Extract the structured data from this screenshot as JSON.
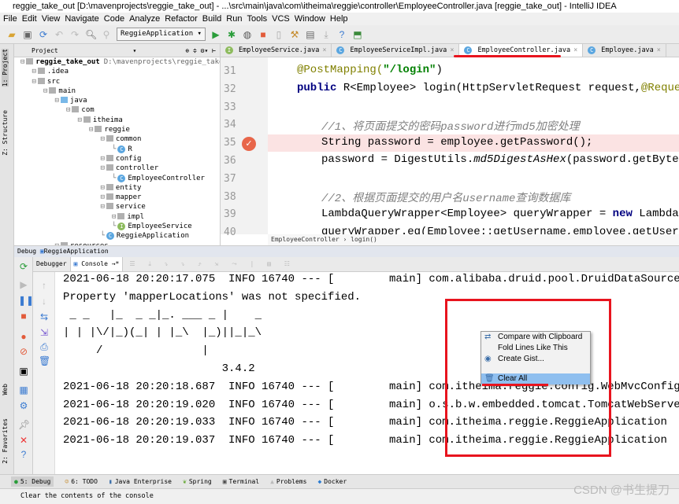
{
  "window": {
    "title": "reggie_take_out [D:\\mavenprojects\\reggie_take_out] - ...\\src\\main\\java\\com\\itheima\\reggie\\controller\\EmployeeController.java [reggie_take_out] - IntelliJ IDEA"
  },
  "menu": [
    "File",
    "Edit",
    "View",
    "Navigate",
    "Code",
    "Analyze",
    "Refactor",
    "Build",
    "Run",
    "Tools",
    "VCS",
    "Window",
    "Help"
  ],
  "toolbar": {
    "run_config": "ReggieApplication"
  },
  "side_tabs": {
    "project": "1: Project",
    "structure": "Z: Structure",
    "web": "Web",
    "favorites": "2: Favorites"
  },
  "project": {
    "header": "Project",
    "tree": [
      {
        "label": "reggie_take_out",
        "extra": "D:\\mavenprojects\\reggie_take_",
        "depth": 0,
        "type": "module"
      },
      {
        "label": ".idea",
        "depth": 1,
        "type": "folder"
      },
      {
        "label": "src",
        "depth": 1,
        "type": "folder"
      },
      {
        "label": "main",
        "depth": 2,
        "type": "folder"
      },
      {
        "label": "java",
        "depth": 3,
        "type": "source"
      },
      {
        "label": "com",
        "depth": 4,
        "type": "folder"
      },
      {
        "label": "itheima",
        "depth": 5,
        "type": "folder"
      },
      {
        "label": "reggie",
        "depth": 6,
        "type": "folder"
      },
      {
        "label": "common",
        "depth": 7,
        "type": "folder"
      },
      {
        "label": "R",
        "depth": 8,
        "type": "class"
      },
      {
        "label": "config",
        "depth": 7,
        "type": "folder"
      },
      {
        "label": "controller",
        "depth": 7,
        "type": "folder"
      },
      {
        "label": "EmployeeController",
        "depth": 8,
        "type": "class"
      },
      {
        "label": "entity",
        "depth": 7,
        "type": "folder"
      },
      {
        "label": "mapper",
        "depth": 7,
        "type": "folder"
      },
      {
        "label": "service",
        "depth": 7,
        "type": "folder"
      },
      {
        "label": "impl",
        "depth": 8,
        "type": "folder"
      },
      {
        "label": "EmployeeService",
        "depth": 8,
        "type": "interface"
      },
      {
        "label": "ReggieApplication",
        "depth": 7,
        "type": "app"
      },
      {
        "label": "resources",
        "depth": 3,
        "type": "folder"
      }
    ]
  },
  "editor": {
    "tabs": [
      {
        "label": "EmployeeService.java",
        "icon": "I",
        "active": false
      },
      {
        "label": "EmployeeServiceImpl.java",
        "icon": "C",
        "active": false
      },
      {
        "label": "EmployeeController.java",
        "icon": "C",
        "active": true
      },
      {
        "label": "Employee.java",
        "icon": "C",
        "active": false
      }
    ],
    "line_numbers": [
      "31",
      "32",
      "33",
      "34",
      "35",
      "36",
      "37",
      "38",
      "39",
      "40"
    ],
    "lines": {
      "l31a": "@PostMapping(",
      "l31b": "\"/login\"",
      "l31c": ")",
      "l32a": "public",
      "l32b": " R<Employee> login(HttpServletRequest request,",
      "l32c": "@RequestBody",
      "l34": "//1、将页面提交的密码password进行md5加密处理",
      "l35": "String password = employee.getPassword();",
      "l36a": "password = DigestUtils.",
      "l36b": "md5DigestAsHex",
      "l36c": "(password.getBytes());",
      "l38": "//2、根据页面提交的用户名username查询数据库",
      "l39a": "LambdaQueryWrapper<Employee> queryWrapper = ",
      "l39b": "new",
      "l39c": " LambdaQueryWrapper<>();",
      "l40": "queryWrapper.eq(Employee::getUsername,employee.getUsername());"
    },
    "breakpoint_line": "35",
    "breadcrumb": [
      "EmployeeController",
      "login()"
    ]
  },
  "debug": {
    "label": "Debug",
    "config": "ReggieApplication",
    "tabs": [
      "Debugger",
      "Console"
    ]
  },
  "console": {
    "lines": [
      {
        "left": "2021-06-18 20:20:17.075  INFO 16740 --- [",
        "right": "main] com.alibaba.druid.pool.DruidDataSource"
      },
      {
        "left": "Property 'mapperLocations' was not specified.",
        "right": ""
      },
      {
        "left": " _ _   |_  _ _|_. ___ _ |    _",
        "right": ""
      },
      {
        "left": "| | |\\/|_)(_| | |_\\  |_)||_|_\\",
        "right": ""
      },
      {
        "left": "     /               |",
        "right": ""
      },
      {
        "left": "                        3.4.2",
        "right": ""
      },
      {
        "left": "2021-06-18 20:20:18.687  INFO 16740 --- [",
        "right": "main] com.itheima.reggie.config.WebMvcConfig"
      },
      {
        "left": "2021-06-18 20:20:19.020  INFO 16740 --- [",
        "right": "main] o.s.b.w.embedded.tomcat.TomcatWebServer"
      },
      {
        "left": "2021-06-18 20:20:19.033  INFO 16740 --- [",
        "right": "main] com.itheima.reggie.ReggieApplication"
      },
      {
        "left": "2021-06-18 20:20:19.037  INFO 16740 --- [",
        "right": "main] com.itheima.reggie.ReggieApplication"
      }
    ]
  },
  "context_menu": {
    "items": [
      {
        "label": "Compare with Clipboard",
        "icon": "compare-icon"
      },
      {
        "label": "Fold Lines Like This",
        "icon": ""
      },
      {
        "label": "Create Gist...",
        "icon": "github-icon"
      },
      {
        "label": "Clear All",
        "icon": "trash-icon",
        "selected": true
      }
    ]
  },
  "bottom_tabs": [
    "5: Debug",
    "6: TODO",
    "Java Enterprise",
    "Spring",
    "Terminal",
    "Problems",
    "Docker"
  ],
  "status": {
    "message": "Clear the contents of the console"
  },
  "watermark": "CSDN @书生提刀",
  "colors": {
    "annotation_red": "#e8141e",
    "selection": "#8fbfef",
    "breakpoint_line": "#fbe3e3"
  }
}
